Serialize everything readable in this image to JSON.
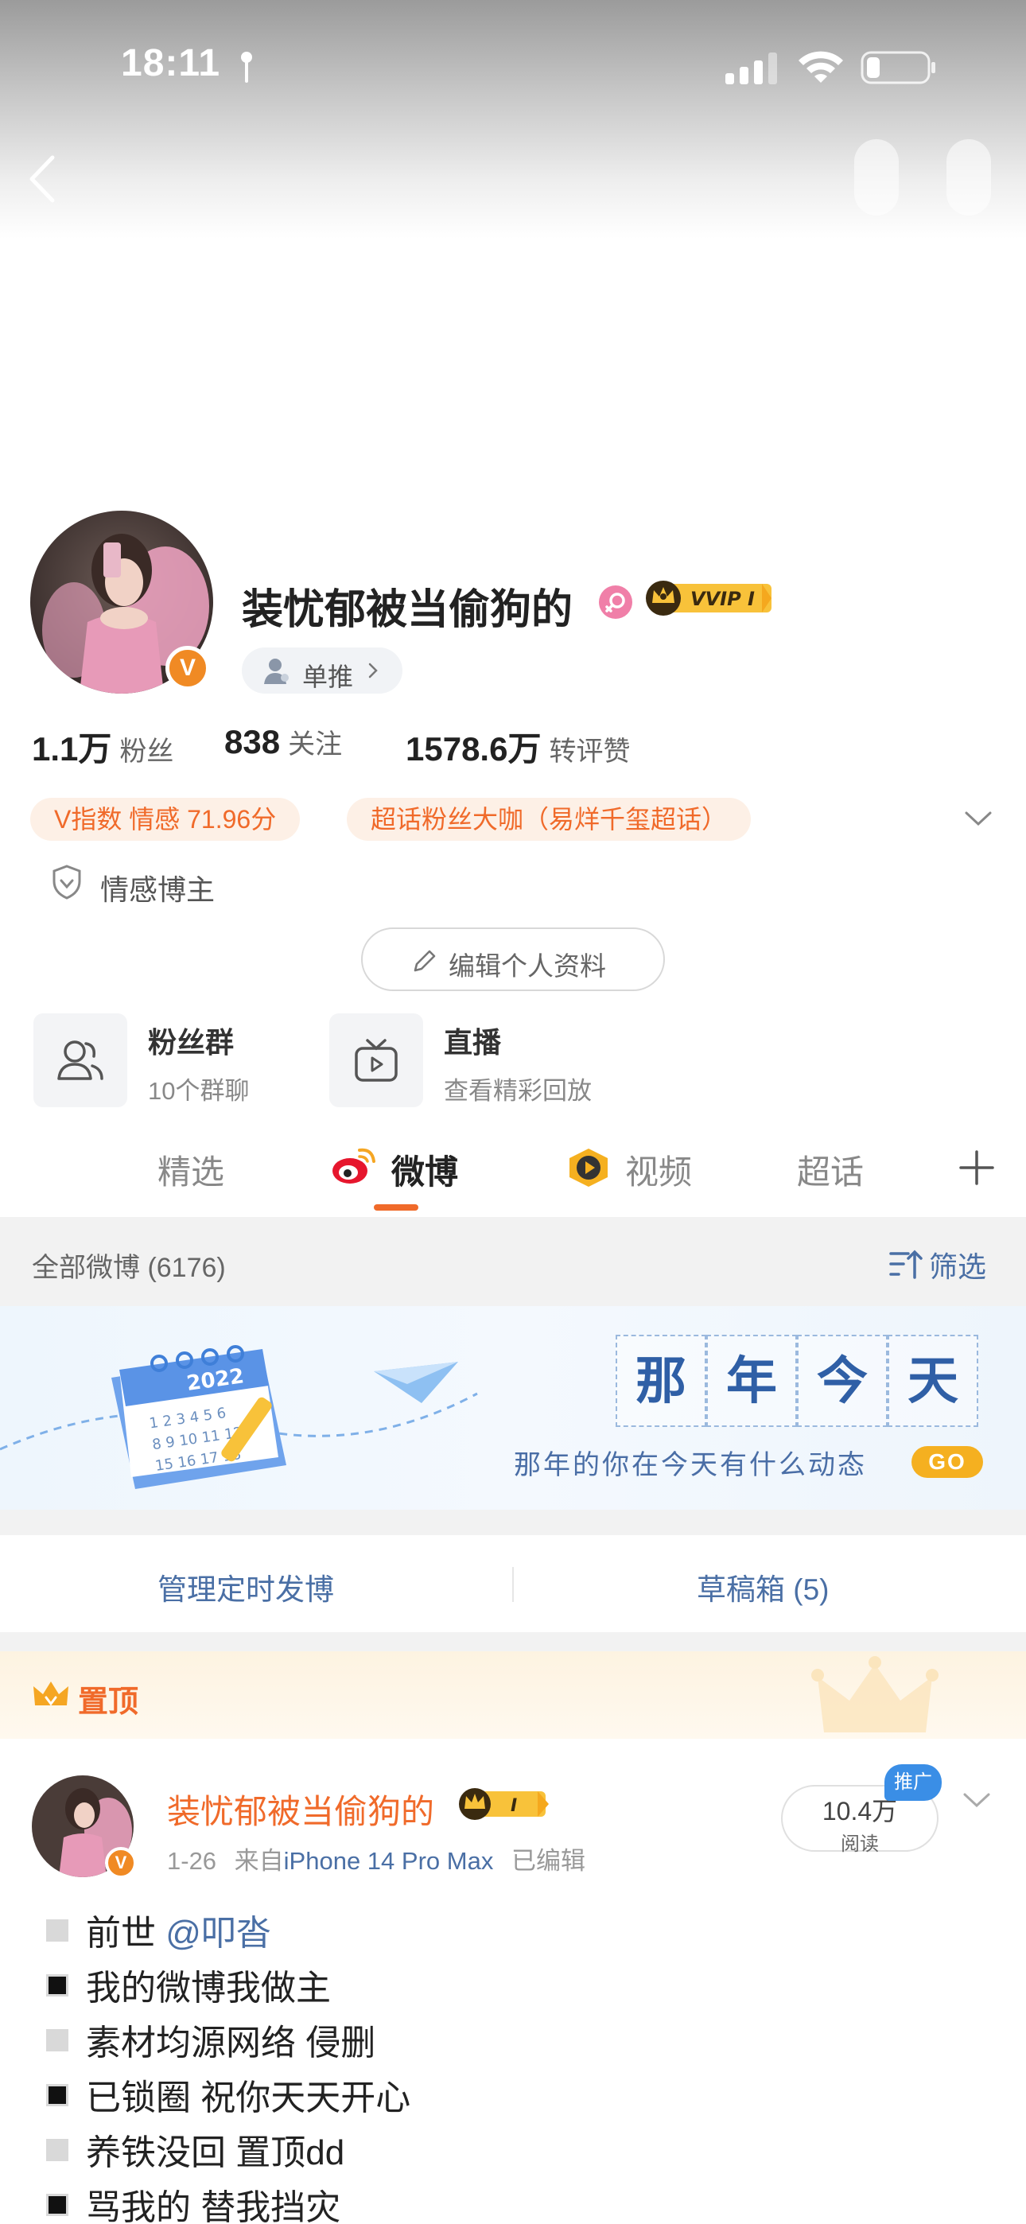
{
  "status_bar": {
    "time": "18:11"
  },
  "profile": {
    "nickname": "装忧郁被当偷狗的",
    "vvip_badge": "VVIP I",
    "dantui_label": "单推",
    "stats": [
      {
        "num": "1.1万",
        "label": "粉丝"
      },
      {
        "num": "838",
        "label": "关注"
      },
      {
        "num": "1578.6万",
        "label": "转评赞"
      }
    ],
    "tags": [
      "V指数 情感 71.96分",
      "超话粉丝大咖（易烊千玺超话）"
    ],
    "role": "情感博主",
    "edit_label": "编辑个人资料",
    "functions": [
      {
        "title": "粉丝群",
        "sub": "10个群聊"
      },
      {
        "title": "直播",
        "sub": "查看精彩回放"
      }
    ]
  },
  "tabs": [
    {
      "label": "精选"
    },
    {
      "label": "微博"
    },
    {
      "label": "视频"
    },
    {
      "label": "超话"
    }
  ],
  "filter": {
    "count_label": "全部微博 (6176)",
    "filter_label": "筛选"
  },
  "banner": {
    "calendar_year": "2022",
    "chars": [
      "那",
      "年",
      "今",
      "天"
    ],
    "subtitle": "那年的你在今天有什么动态",
    "go": "GO"
  },
  "manage": {
    "scheduled": "管理定时发博",
    "drafts": "草稿箱 (5)"
  },
  "pinned": {
    "label": "置顶"
  },
  "post": {
    "author": "装忧郁被当偷狗的",
    "badge": "I",
    "date": "1-26",
    "from_prefix": "来自",
    "source": "iPhone 14 Pro Max",
    "edited": "已编辑",
    "reads_num": "10.4万",
    "reads_label": "阅读",
    "promo": "推广",
    "lines": [
      {
        "style": "light",
        "text": "前世 ",
        "mention": "@叩沓"
      },
      {
        "style": "dark",
        "text": "我的微博我做主"
      },
      {
        "style": "light",
        "text": "素材均源网络 侵删"
      },
      {
        "style": "dark",
        "text": "已锁圈 祝你天天开心"
      },
      {
        "style": "light",
        "text": "养铁没回 置顶dd"
      },
      {
        "style": "dark",
        "text": "骂我的 替我挡灾"
      }
    ]
  },
  "colors": {
    "accent": "#f06a2a",
    "link": "#4a6fa5",
    "vip_gold": "#f5b020"
  }
}
